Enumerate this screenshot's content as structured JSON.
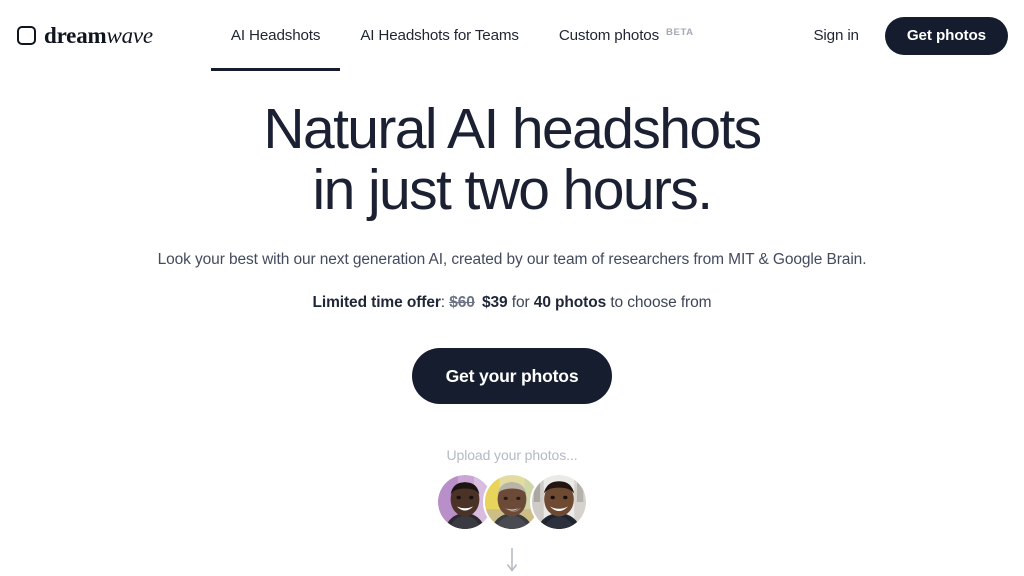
{
  "header": {
    "logo": {
      "icon": "rounded-square-logo-icon",
      "word_primary": "dream",
      "word_secondary": "wave"
    },
    "nav": [
      {
        "label": "AI Headshots",
        "active": true,
        "badge": ""
      },
      {
        "label": "AI Headshots for Teams",
        "active": false,
        "badge": ""
      },
      {
        "label": "Custom photos",
        "active": false,
        "badge": "BETA"
      }
    ],
    "signin_label": "Sign in",
    "get_photos_label": "Get photos"
  },
  "hero": {
    "title": "Natural AI headshots\nin just two hours.",
    "subtitle": "Look your best with our next generation AI, created by our team of researchers from MIT & Google Brain.",
    "offer": {
      "lead": "Limited time offer",
      "colon": ":",
      "old_price": "$60",
      "new_price": "$39",
      "for": "for",
      "quantity": "40 photos",
      "tail": "to choose from"
    },
    "cta_label": "Get your photos"
  },
  "upload": {
    "label": "Upload your photos...",
    "avatars": [
      {
        "name": "avatar-photo-1",
        "bg": "#c9a6d4",
        "skin": "#4a3326",
        "shirt": "#2a2a30"
      },
      {
        "name": "avatar-photo-2",
        "bg": "#d9cf6a",
        "skin": "#6b4b38",
        "shirt": "#3b3b42"
      },
      {
        "name": "avatar-photo-3",
        "bg": "#e8e6e3",
        "skin": "#6e4a33",
        "shirt": "#20242e"
      }
    ],
    "scroll_icon": "arrow-down-icon"
  },
  "colors": {
    "brand_dark": "#151c2d",
    "text_primary": "#1b2133",
    "text_muted": "#434b5e",
    "text_light": "#b4b9c4",
    "page_bg": "#ffffff"
  }
}
